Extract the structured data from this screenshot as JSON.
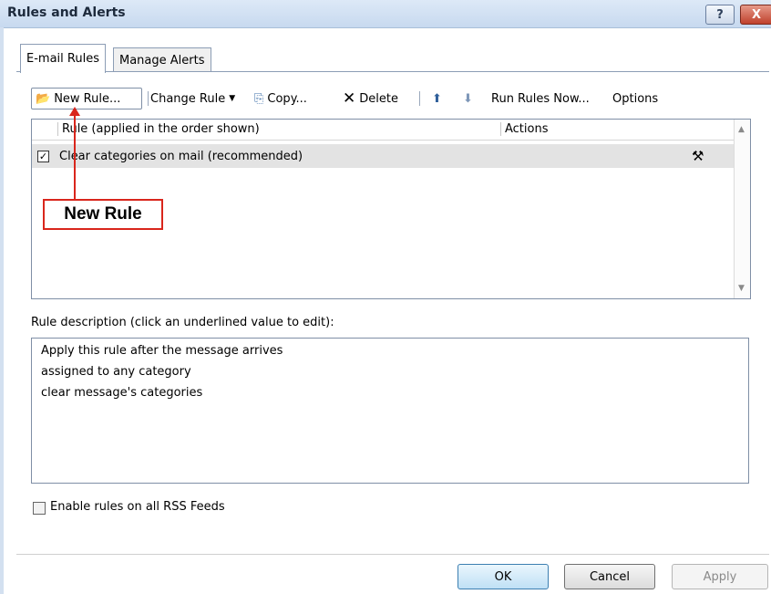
{
  "window": {
    "title": "Rules and Alerts",
    "help_label": "?",
    "close_label": "X"
  },
  "tabs": [
    {
      "label": "E-mail Rules"
    },
    {
      "label": "Manage Alerts"
    }
  ],
  "toolbar": {
    "new_rule": "New Rule...",
    "change_rule": "Change Rule",
    "copy": "Copy...",
    "delete": "Delete",
    "run_rules_now": "Run Rules Now...",
    "options": "Options"
  },
  "rules_list": {
    "col_rule": "Rule (applied in the order shown)",
    "col_actions": "Actions",
    "rows": [
      {
        "name": "Clear categories on mail (recommended)",
        "checked": true
      }
    ]
  },
  "callout": {
    "label": "New Rule",
    "color": "#d9261c"
  },
  "description": {
    "label": "Rule description (click an underlined value to edit):",
    "lines": [
      "Apply this rule after the message arrives",
      "assigned to any category",
      "clear message's categories"
    ]
  },
  "rss": {
    "label": "Enable rules on all RSS Feeds",
    "checked": false
  },
  "buttons": {
    "ok": "OK",
    "cancel": "Cancel",
    "apply": "Apply"
  }
}
